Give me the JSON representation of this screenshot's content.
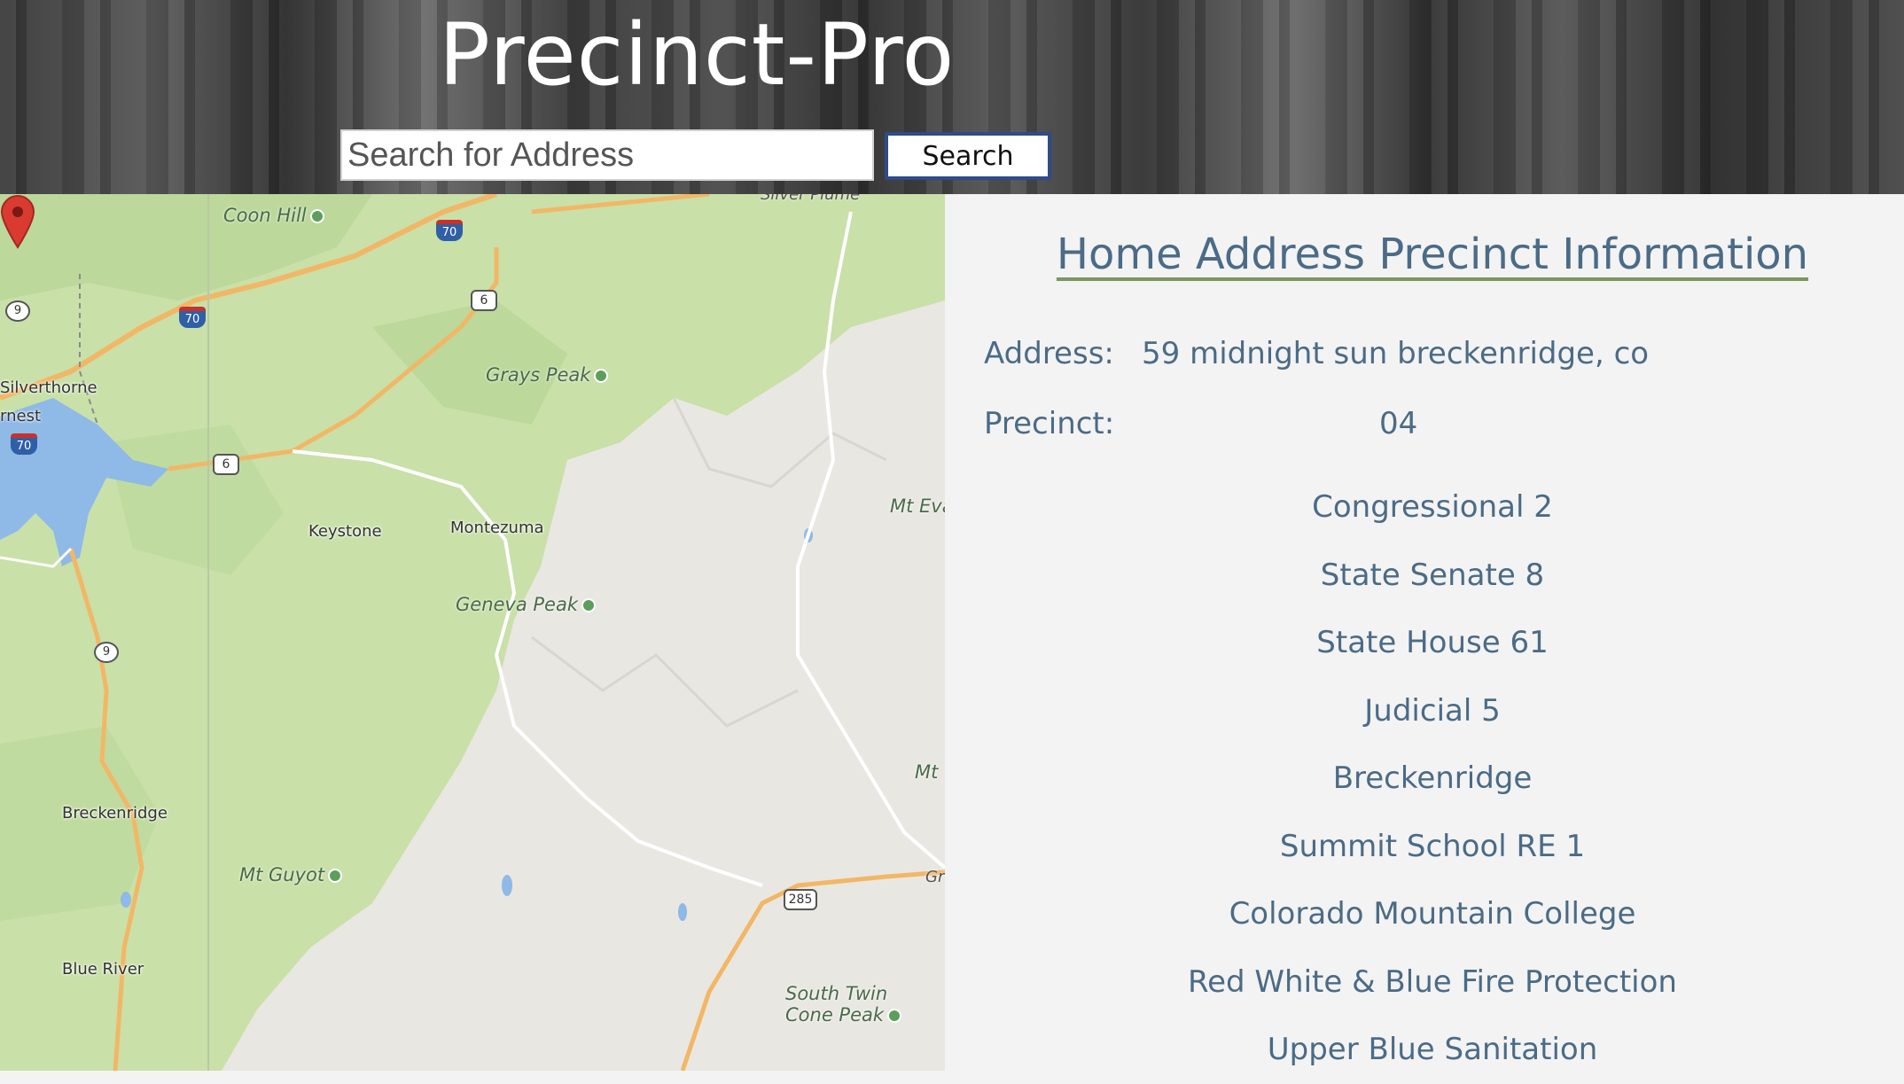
{
  "header": {
    "title": "Precinct-Pro",
    "search_placeholder": "Search for Address",
    "search_button_label": "Search"
  },
  "map": {
    "labels": {
      "coon_hill": "Coon Hill",
      "silver_plume": "Silver Plume",
      "silverthorne": "Silverthorne",
      "frisco_partial": "rnest",
      "grays_peak": "Grays Peak",
      "keystone": "Keystone",
      "montezuma": "Montezuma",
      "mt_evans": "Mt Eva",
      "geneva_peak": "Geneva Peak",
      "mt_partial": "Mt",
      "breckenridge": "Breckenridge",
      "mt_guyot": "Mt Guyot",
      "gr_partial": "Gr",
      "blue_river": "Blue River",
      "south_twin_cone_1": "South Twin",
      "south_twin_cone_2": "Cone Peak"
    },
    "shields": {
      "i70_a": "70",
      "i70_b": "70",
      "i70_c": "70",
      "us6_a": "6",
      "us6_b": "6",
      "co9_a": "9",
      "co9_b": "9",
      "us285": "285"
    },
    "marker_color": "#d93b30"
  },
  "info": {
    "title": "Home Address Precinct Information",
    "address_label": "Address:",
    "address_value": "59 midnight sun breckenridge, co",
    "precinct_label": "Precinct:",
    "precinct_value": "04",
    "districts": [
      "Congressional 2",
      "State Senate 8",
      "State House 61",
      "Judicial 5",
      "Breckenridge",
      "Summit School RE 1",
      "Colorado Mountain College",
      "Red White & Blue Fire Protection",
      "Upper Blue Sanitation"
    ]
  },
  "colors": {
    "text_blue": "#4b6b86",
    "underline_green": "#7b9660",
    "forest": "#c9e0a9",
    "alpine": "#e9e7e2",
    "water": "#8fb9e6",
    "button_border": "#2f4b88"
  }
}
